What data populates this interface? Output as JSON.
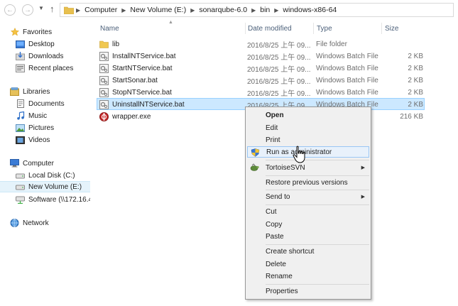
{
  "address_bar": {
    "crumbs": [
      "Computer",
      "New Volume (E:)",
      "sonarqube-6.0",
      "bin",
      "windows-x86-64"
    ]
  },
  "nav_pane": {
    "favorites": {
      "header": "Favorites",
      "items": [
        "Desktop",
        "Downloads",
        "Recent places"
      ]
    },
    "libraries": {
      "header": "Libraries",
      "items": [
        "Documents",
        "Music",
        "Pictures",
        "Videos"
      ]
    },
    "computer": {
      "header": "Computer",
      "items": [
        "Local Disk (C:)",
        "New Volume (E:)",
        "Software (\\\\172.16.4"
      ]
    },
    "network": {
      "header": "Network"
    },
    "selected": "New Volume (E:)"
  },
  "columns": {
    "name": "Name",
    "date": "Date modified",
    "type": "Type",
    "size": "Size"
  },
  "files": [
    {
      "name": "lib",
      "date": "2016/8/25 上午 09...",
      "type": "File folder",
      "size": "",
      "icon": "folder-icon"
    },
    {
      "name": "InstallNTService.bat",
      "date": "2016/8/25 上午 09...",
      "type": "Windows Batch File",
      "size": "2 KB",
      "icon": "batch-file-icon"
    },
    {
      "name": "StartNTService.bat",
      "date": "2016/8/25 上午 09...",
      "type": "Windows Batch File",
      "size": "2 KB",
      "icon": "batch-file-icon"
    },
    {
      "name": "StartSonar.bat",
      "date": "2016/8/25 上午 09...",
      "type": "Windows Batch File",
      "size": "2 KB",
      "icon": "batch-file-icon"
    },
    {
      "name": "StopNTService.bat",
      "date": "2016/8/25 上午 09...",
      "type": "Windows Batch File",
      "size": "2 KB",
      "icon": "batch-file-icon"
    },
    {
      "name": "UninstallNTService.bat",
      "date": "2016/8/25 上午 09...",
      "type": "Windows Batch File",
      "size": "2 KB",
      "icon": "batch-file-icon"
    },
    {
      "name": "wrapper.exe",
      "date": "",
      "type": "",
      "size": "216 KB",
      "icon": "wrapper-exe-icon"
    }
  ],
  "selected_file": "UninstallNTService.bat",
  "context_menu": {
    "items": {
      "open": "Open",
      "edit": "Edit",
      "print": "Print",
      "run_as_admin": "Run as administrator",
      "tortoisesvn": "TortoiseSVN",
      "restore": "Restore previous versions",
      "send_to": "Send to",
      "cut": "Cut",
      "copy": "Copy",
      "paste": "Paste",
      "create_shortcut": "Create shortcut",
      "delete": "Delete",
      "rename": "Rename",
      "properties": "Properties"
    },
    "hovered": "Run as administrator"
  },
  "colors": {
    "selection_bg": "#cce8ff",
    "selection_border": "#99d1ff",
    "header_text": "#4c607a",
    "menu_bg": "#f0f0f0",
    "hover_bg": "#e8f1fb"
  }
}
